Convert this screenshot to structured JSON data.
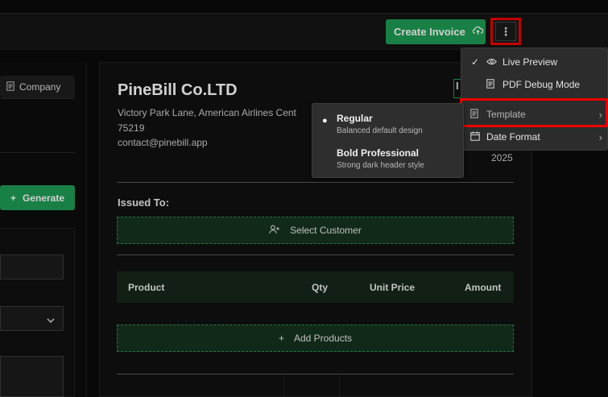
{
  "header": {
    "create_invoice_label": "Create Invoice",
    "more_label": "⋮"
  },
  "left": {
    "company_tab_label": "Company",
    "generate_label": "Generate"
  },
  "invoice": {
    "company_name": "PineBill Co.LTD",
    "address_line1": "Victory Park Lane, American Airlines Cent",
    "address_line2": "75219",
    "email": "contact@pinebill.app",
    "badge_text": "I",
    "year": "2025",
    "issued_to_label": "Issued To:",
    "select_customer_label": "Select Customer",
    "add_products_label": "Add Products",
    "table_headers": {
      "product": "Product",
      "qty": "Qty",
      "unit_price": "Unit Price",
      "amount": "Amount"
    }
  },
  "menu": {
    "live_preview": "Live Preview",
    "pdf_debug": "PDF Debug Mode",
    "template": "Template",
    "date_format": "Date Format"
  },
  "template_submenu": {
    "items": [
      {
        "title": "Regular",
        "desc": "Balanced default design",
        "selected": true
      },
      {
        "title": "Bold Professional",
        "desc": "Strong dark header style",
        "selected": false
      }
    ]
  },
  "colors": {
    "accent_green": "#1f9d55",
    "highlight_red": "#e00000"
  }
}
